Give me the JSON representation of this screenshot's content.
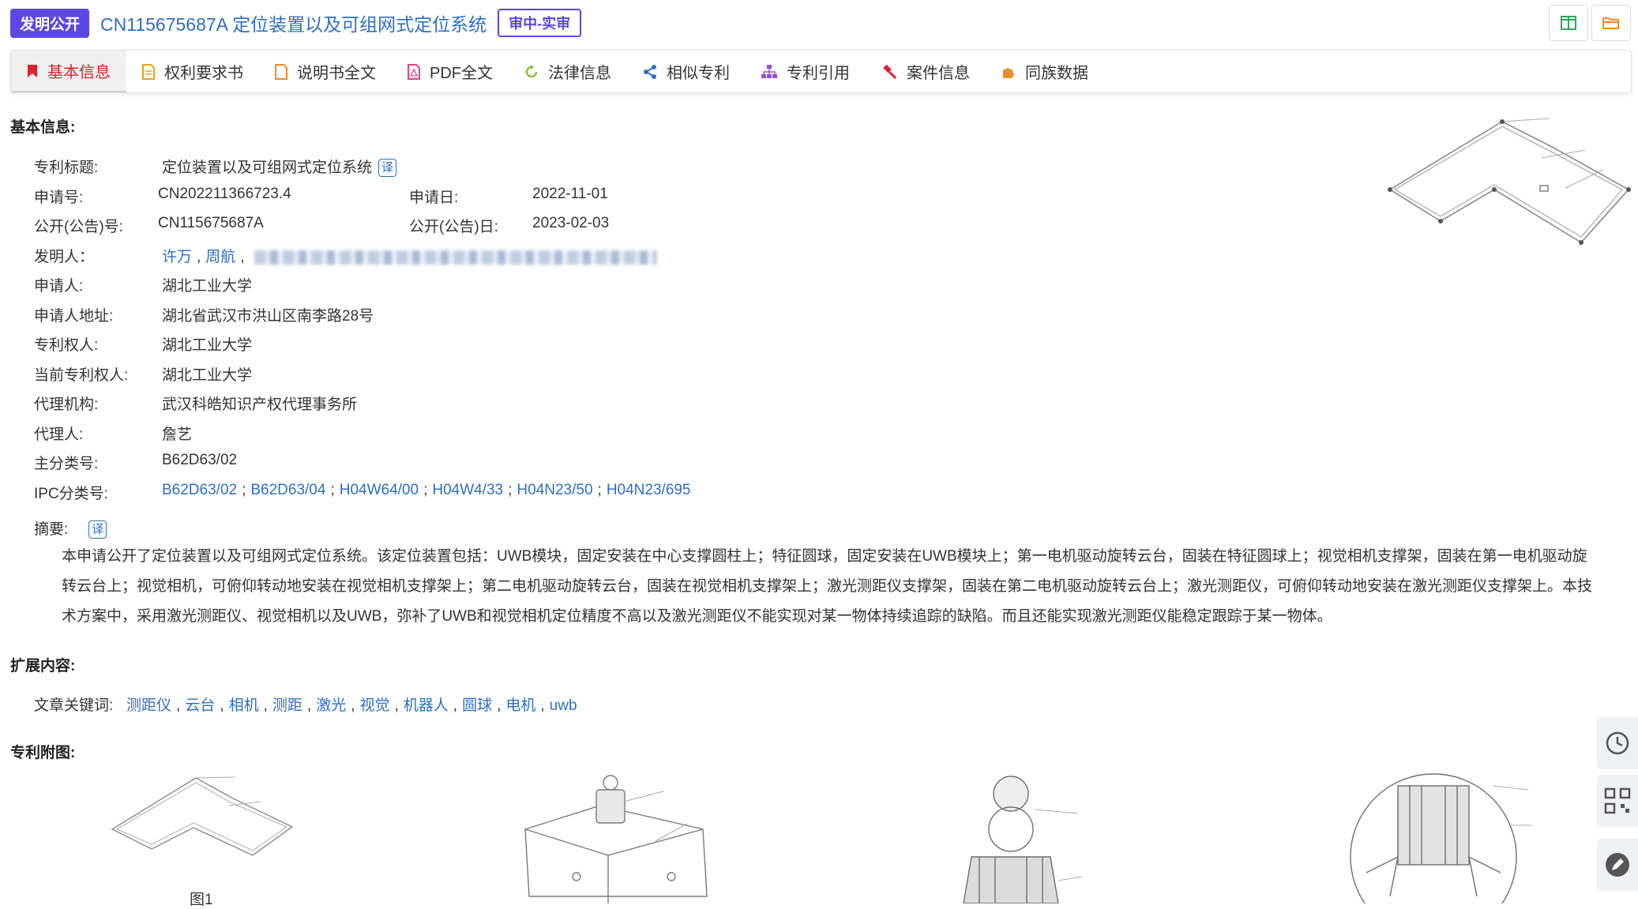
{
  "header": {
    "type_badge": "发明公开",
    "title": "CN115675687A 定位装置以及可组网式定位系统",
    "status_badge": "审中-实审"
  },
  "colors": {
    "accent": "#5b48e4",
    "link": "#2d6fc1",
    "active_tab": "#d9232d"
  },
  "tabs": [
    {
      "label": "基本信息",
      "icon": "bookmark-icon",
      "active": true
    },
    {
      "label": "权利要求书",
      "icon": "document-icon"
    },
    {
      "label": "说明书全文",
      "icon": "file-icon"
    },
    {
      "label": "PDF全文",
      "icon": "pdf-icon"
    },
    {
      "label": "法律信息",
      "icon": "refresh-icon"
    },
    {
      "label": "相似专利",
      "icon": "share-icon"
    },
    {
      "label": "专利引用",
      "icon": "hierarchy-icon"
    },
    {
      "label": "案件信息",
      "icon": "gavel-icon"
    },
    {
      "label": "同族数据",
      "icon": "puzzle-icon"
    }
  ],
  "basic": {
    "section_title": "基本信息:",
    "title_label": "专利标题:",
    "title_value": "定位装置以及可组网式定位系统",
    "translate": "译",
    "app_no_label": "申请号:",
    "app_no": "CN202211366723.4",
    "app_date_label": "申请日:",
    "app_date": "2022-11-01",
    "pub_no_label": "公开(公告)号:",
    "pub_no": "CN115675687A",
    "pub_date_label": "公开(公告)日:",
    "pub_date": "2023-02-03",
    "inventor_label": "发明人：",
    "inventors": [
      "许万",
      "周航"
    ],
    "applicant_label": "申请人:",
    "applicant": "湖北工业大学",
    "address_label": "申请人地址:",
    "address": "湖北省武汉市洪山区南李路28号",
    "patentee_label": "专利权人:",
    "patentee": "湖北工业大学",
    "current_patentee_label": "当前专利权人:",
    "current_patentee": "湖北工业大学",
    "agency_label": "代理机构:",
    "agency": "武汉科皓知识产权代理事务所",
    "agent_label": "代理人:",
    "agent": "詹艺",
    "main_class_label": "主分类号:",
    "main_class": "B62D63/02",
    "ipc_label": "IPC分类号:",
    "ipc": [
      "B62D63/02",
      "B62D63/04",
      "H04W64/00",
      "H04W4/33",
      "H04N23/50",
      "H04N23/695"
    ],
    "abstract_label": "摘要:",
    "abstract": "本申请公开了定位装置以及可组网式定位系统。该定位装置包括：UWB模块，固定安装在中心支撑圆柱上；特征圆球，固定安装在UWB模块上；第一电机驱动旋转云台，固装在特征圆球上；视觉相机支撑架，固装在第一电机驱动旋转云台上；视觉相机，可俯仰转动地安装在视觉相机支撑架上；第二电机驱动旋转云台，固装在视觉相机支撑架上；激光测距仪支撑架，固装在第二电机驱动旋转云台上；激光测距仪，可俯仰转动地安装在激光测距仪支撑架上。本技术方案中，采用激光测距仪、视觉相机以及UWB，弥补了UWB和视觉相机定位精度不高以及激光测距仪不能实现对某一物体持续追踪的缺陷。而且还能实现激光测距仪能稳定跟踪于某一物体。"
  },
  "extended": {
    "section_title": "扩展内容:",
    "keywords_label": "文章关键词:",
    "keywords": [
      "测距仪",
      "云台",
      "相机",
      "测距",
      "激光",
      "视觉",
      "机器人",
      "圆球",
      "电机",
      "uwb"
    ]
  },
  "figures": {
    "section_title": "专利附图:",
    "caption_1": "图1"
  }
}
